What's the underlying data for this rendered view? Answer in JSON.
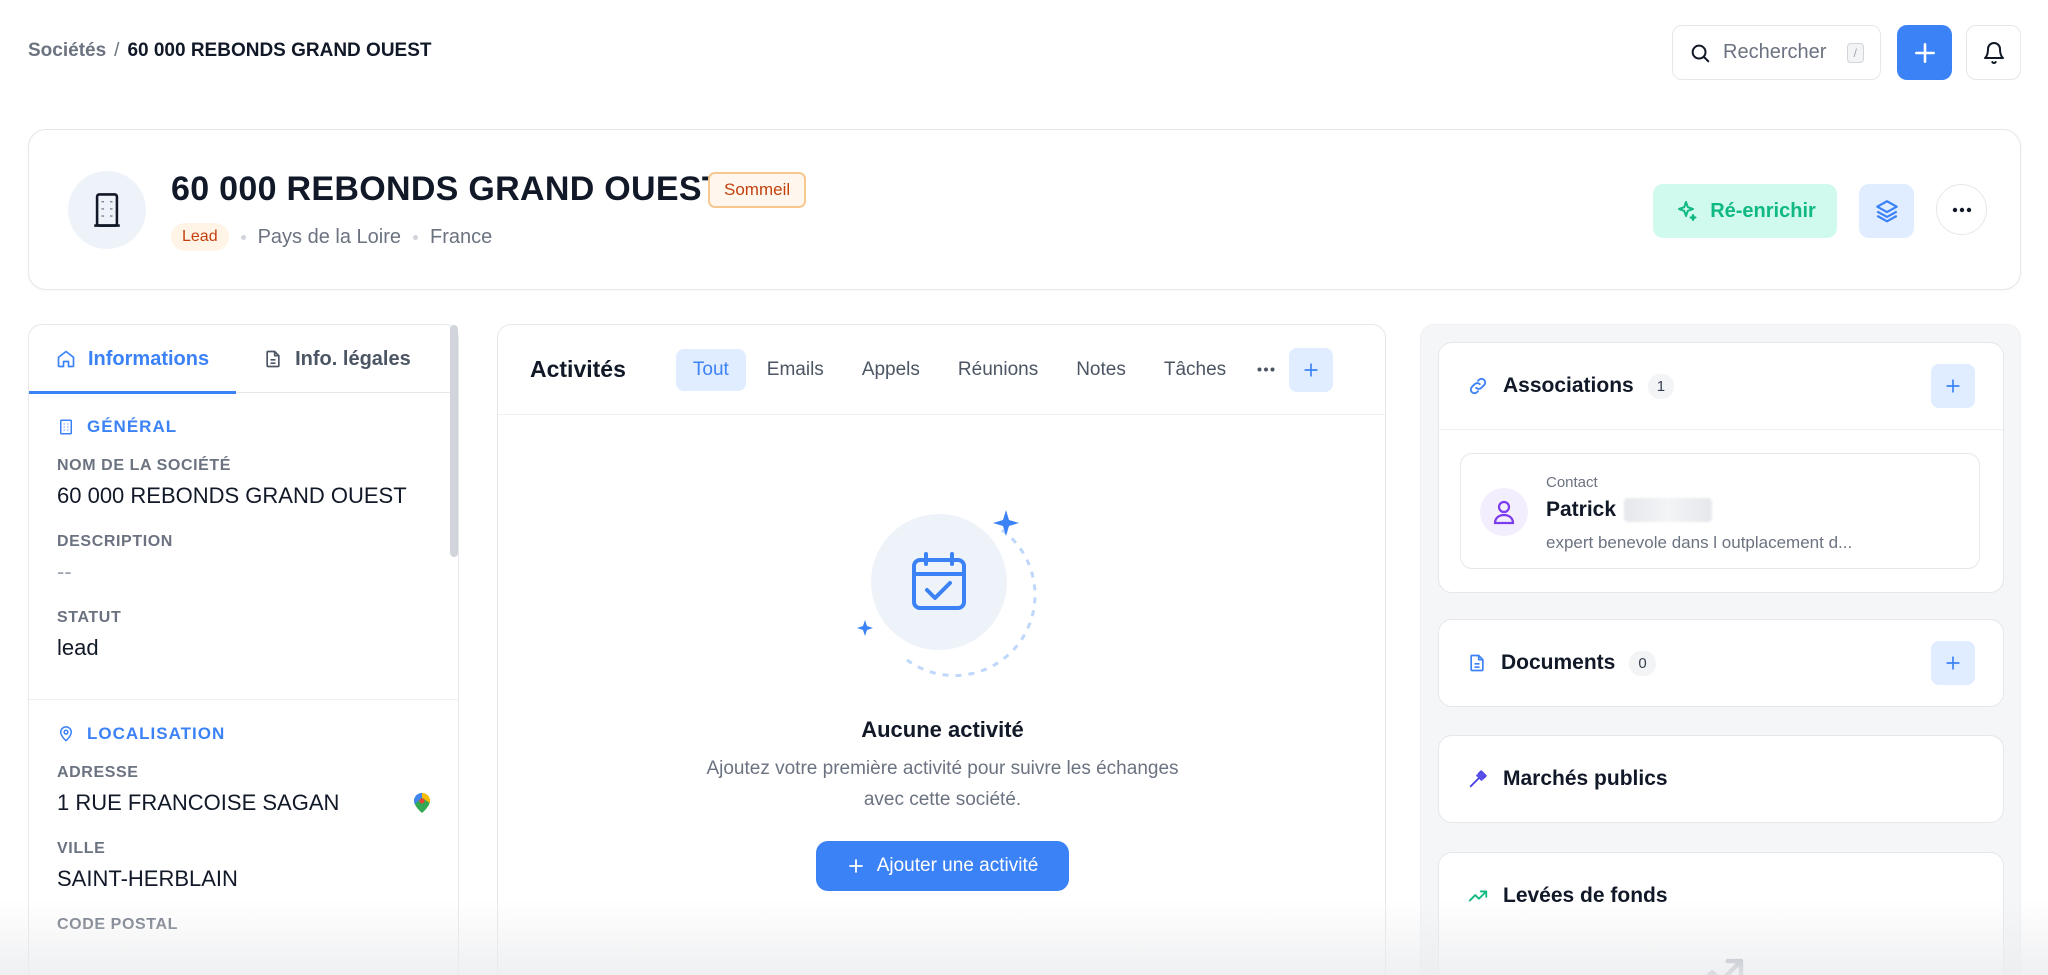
{
  "breadcrumb": {
    "parent": "Sociétés",
    "separator": "/",
    "current": "60 000 REBONDS GRAND OUEST"
  },
  "search": {
    "placeholder": "Rechercher",
    "shortcut": "/"
  },
  "company": {
    "name": "60 000 REBONDS GRAND OUEST",
    "status_badge": "Sommeil",
    "lead_pill": "Lead",
    "region": "Pays de la Loire",
    "country": "France",
    "enrich_label": "Ré-enrichir"
  },
  "left_tabs": [
    {
      "label": "Informations",
      "icon": "home-icon"
    },
    {
      "label": "Info. légales",
      "icon": "document-icon"
    }
  ],
  "general": {
    "title": "GÉNÉRAL",
    "name_label": "NOM DE LA SOCIÉTÉ",
    "name_value": "60 000 REBONDS GRAND OUEST",
    "description_label": "DESCRIPTION",
    "description_value": "--",
    "status_label": "STATUT",
    "status_value": "lead"
  },
  "location": {
    "title": "LOCALISATION",
    "address_label": "ADRESSE",
    "address_value": "1 RUE FRANCOISE SAGAN",
    "city_label": "VILLE",
    "city_value": "SAINT-HERBLAIN",
    "postal_label": "CODE POSTAL"
  },
  "activities": {
    "title": "Activités",
    "tabs": [
      "Tout",
      "Emails",
      "Appels",
      "Réunions",
      "Notes",
      "Tâches"
    ],
    "empty_title": "Aucune activité",
    "empty_desc": "Ajoutez votre première activité pour suivre les échanges avec cette société.",
    "add_label": "Ajouter une activité"
  },
  "associations": {
    "title": "Associations",
    "count": "1",
    "contact_kind": "Contact",
    "contact_name": "Patrick",
    "contact_desc": "expert benevole dans l outplacement d..."
  },
  "documents": {
    "title": "Documents",
    "count": "0"
  },
  "public_markets": {
    "title": "Marchés publics"
  },
  "fundraising": {
    "title": "Levées de fonds"
  },
  "colors": {
    "primary": "#3b82f6",
    "enrich_bg": "#d1faee",
    "enrich_text": "#10b981",
    "badge_orange": "#c2410c"
  }
}
